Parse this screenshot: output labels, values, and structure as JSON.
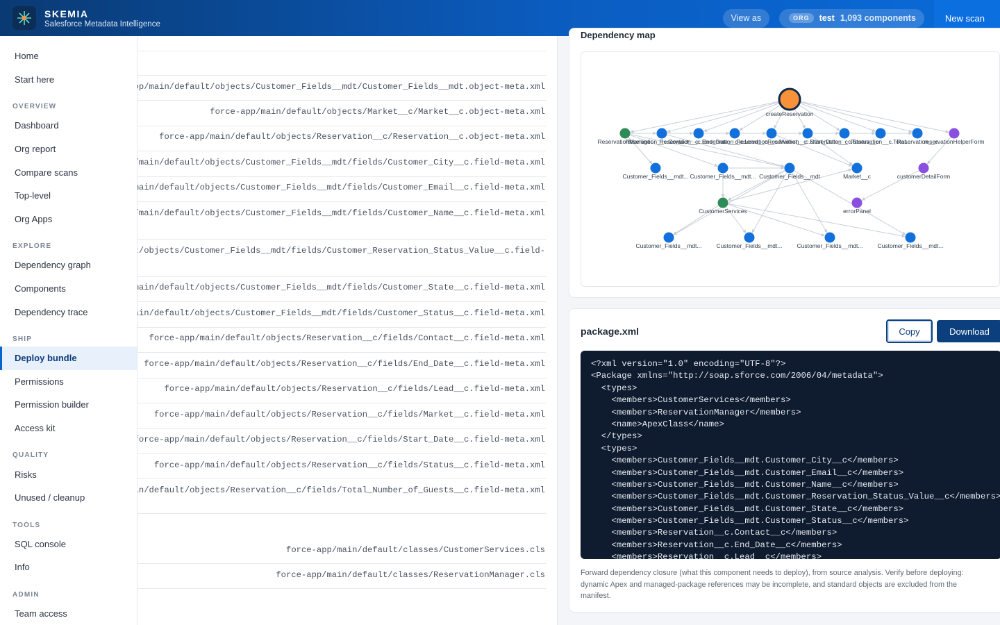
{
  "header": {
    "brand_name": "SKEMIA",
    "brand_sub": "Salesforce Metadata Intelligence",
    "view_as": "View as",
    "org_tag": "ORG",
    "org_name": "test",
    "org_count": "1,093 components",
    "new_scan": "New scan"
  },
  "sidebar": {
    "items": [
      {
        "type": "item",
        "label": "Home"
      },
      {
        "type": "item",
        "label": "Start here"
      },
      {
        "type": "section",
        "label": "OVERVIEW"
      },
      {
        "type": "item",
        "label": "Dashboard"
      },
      {
        "type": "item",
        "label": "Org report"
      },
      {
        "type": "item",
        "label": "Compare scans"
      },
      {
        "type": "item",
        "label": "Top-level"
      },
      {
        "type": "item",
        "label": "Org Apps"
      },
      {
        "type": "section",
        "label": "EXPLORE"
      },
      {
        "type": "item",
        "label": "Dependency graph"
      },
      {
        "type": "item",
        "label": "Components"
      },
      {
        "type": "item",
        "label": "Dependency trace"
      },
      {
        "type": "section",
        "label": "SHIP"
      },
      {
        "type": "item",
        "label": "Deploy bundle",
        "active": true
      },
      {
        "type": "item",
        "label": "Permissions"
      },
      {
        "type": "item",
        "label": "Permission builder"
      },
      {
        "type": "item",
        "label": "Access kit"
      },
      {
        "type": "section",
        "label": "QUALITY"
      },
      {
        "type": "item",
        "label": "Risks"
      },
      {
        "type": "item",
        "label": "Unused / cleanup"
      },
      {
        "type": "section",
        "label": "TOOLS"
      },
      {
        "type": "item",
        "label": "SQL console"
      },
      {
        "type": "item",
        "label": "Info"
      },
      {
        "type": "section",
        "label": "ADMIN"
      },
      {
        "type": "item",
        "label": "Team access"
      }
    ]
  },
  "files": [
    "force-app/main/default/objects/Customer_Fields__mdt/Customer_Fields__mdt.object-meta.xml",
    "force-app/main/default/objects/Market__c/Market__c.object-meta.xml",
    "force-app/main/default/objects/Reservation__c/Reservation__c.object-meta.xml",
    "force-app/main/default/objects/Customer_Fields__mdt/fields/Customer_City__c.field-meta.xml",
    "force-app/main/default/objects/Customer_Fields__mdt/fields/Customer_Email__c.field-meta.xml",
    "force-app/main/default/objects/Customer_Fields__mdt/fields/Customer_Name__c.field-meta.xml",
    "force-app/main/default/objects/Customer_Fields__mdt/fields/Customer_Reservation_Status_Value__c.field-",
    "force-app/main/default/objects/Customer_Fields__mdt/fields/Customer_State__c.field-meta.xml",
    "force-app/main/default/objects/Customer_Fields__mdt/fields/Customer_Status__c.field-meta.xml",
    "force-app/main/default/objects/Reservation__c/fields/Contact__c.field-meta.xml",
    "force-app/main/default/objects/Reservation__c/fields/End_Date__c.field-meta.xml",
    "force-app/main/default/objects/Reservation__c/fields/Lead__c.field-meta.xml",
    "force-app/main/default/objects/Reservation__c/fields/Market__c.field-meta.xml",
    "force-app/main/default/objects/Reservation__c/fields/Start_Date__c.field-meta.xml",
    "force-app/main/default/objects/Reservation__c/fields/Status__c.field-meta.xml",
    "force-app/main/default/objects/Reservation__c/fields/Total_Number_of_Guests__c.field-meta.xml",
    "force-app/main/default/classes/CustomerServices.cls",
    "force-app/main/default/classes/ReservationManager.cls"
  ],
  "graph": {
    "title": "Dependency map",
    "colors": {
      "root": "#f7923a",
      "blue": "#1170db",
      "green": "#2e8b57",
      "purple": "#8a4fe0"
    },
    "nodes": [
      {
        "id": "root",
        "label": "createReservation",
        "color": "root"
      },
      {
        "id": "n1",
        "label": "ReservationManager",
        "color": "green"
      },
      {
        "id": "n2",
        "label": "Reservation__c.Contact__c",
        "color": "blue"
      },
      {
        "id": "n3",
        "label": "Reservation__c.End_Date__c",
        "color": "blue"
      },
      {
        "id": "n4",
        "label": "Reservation__c.Lead__c",
        "color": "blue"
      },
      {
        "id": "n5",
        "label": "Reservation__c.Market__c",
        "color": "blue"
      },
      {
        "id": "n6",
        "label": "Reservation__c.Start_Date__c",
        "color": "blue"
      },
      {
        "id": "n7",
        "label": "Reservation__c.Status__c",
        "color": "blue"
      },
      {
        "id": "n8",
        "label": "Reservation__c.Total...",
        "color": "blue"
      },
      {
        "id": "n9",
        "label": "Reservation__c",
        "color": "blue"
      },
      {
        "id": "n10",
        "label": "reservationHelperForm",
        "color": "purple"
      },
      {
        "id": "m1",
        "label": "Customer_Fields__mdt...",
        "color": "blue"
      },
      {
        "id": "m2",
        "label": "Customer_Fields__mdt...",
        "color": "blue"
      },
      {
        "id": "m3",
        "label": "Customer_Fields__mdt",
        "color": "blue"
      },
      {
        "id": "m4",
        "label": "Market__c",
        "color": "blue"
      },
      {
        "id": "m5",
        "label": "customerDetailForm",
        "color": "purple"
      },
      {
        "id": "c1",
        "label": "CustomerServices",
        "color": "green"
      },
      {
        "id": "c2",
        "label": "errorPanel",
        "color": "purple"
      },
      {
        "id": "b1",
        "label": "Customer_Fields__mdt...",
        "color": "blue"
      },
      {
        "id": "b2",
        "label": "Customer_Fields__mdt...",
        "color": "blue"
      },
      {
        "id": "b3",
        "label": "Customer_Fields__mdt...",
        "color": "blue"
      },
      {
        "id": "b4",
        "label": "Customer_Fields__mdt...",
        "color": "blue"
      }
    ],
    "edges": [
      [
        "root",
        "n1"
      ],
      [
        "root",
        "n2"
      ],
      [
        "root",
        "n3"
      ],
      [
        "root",
        "n4"
      ],
      [
        "root",
        "n5"
      ],
      [
        "root",
        "n6"
      ],
      [
        "root",
        "n7"
      ],
      [
        "root",
        "n8"
      ],
      [
        "root",
        "n9"
      ],
      [
        "root",
        "n10"
      ],
      [
        "n1",
        "n2"
      ],
      [
        "n2",
        "n3"
      ],
      [
        "n3",
        "n4"
      ],
      [
        "n4",
        "n5"
      ],
      [
        "n5",
        "n6"
      ],
      [
        "n6",
        "n7"
      ],
      [
        "n7",
        "n8"
      ],
      [
        "n8",
        "n9"
      ],
      [
        "n1",
        "m1"
      ],
      [
        "n1",
        "m2"
      ],
      [
        "n1",
        "m3"
      ],
      [
        "n2",
        "m3"
      ],
      [
        "n5",
        "m4"
      ],
      [
        "n10",
        "m5"
      ],
      [
        "n6",
        "m4"
      ],
      [
        "m2",
        "m3"
      ],
      [
        "m3",
        "c1"
      ],
      [
        "m2",
        "c1"
      ],
      [
        "m5",
        "c2"
      ],
      [
        "c1",
        "m4"
      ],
      [
        "c1",
        "b1"
      ],
      [
        "c1",
        "b2"
      ],
      [
        "c1",
        "b3"
      ],
      [
        "c1",
        "b4"
      ],
      [
        "m3",
        "b1"
      ],
      [
        "m3",
        "b2"
      ],
      [
        "m3",
        "b3"
      ],
      [
        "m3",
        "b4"
      ]
    ]
  },
  "package": {
    "title": "package.xml",
    "copy_label": "Copy",
    "download_label": "Download",
    "lines": [
      "<?xml version=\"1.0\" encoding=\"UTF-8\"?>",
      "<Package xmlns=\"http://soap.sforce.com/2006/04/metadata\">",
      "  <types>",
      "    <members>CustomerServices</members>",
      "    <members>ReservationManager</members>",
      "    <name>ApexClass</name>",
      "  </types>",
      "  <types>",
      "    <members>Customer_Fields__mdt.Customer_City__c</members>",
      "    <members>Customer_Fields__mdt.Customer_Email__c</members>",
      "    <members>Customer_Fields__mdt.Customer_Name__c</members>",
      "    <members>Customer_Fields__mdt.Customer_Reservation_Status_Value__c</members>",
      "    <members>Customer_Fields__mdt.Customer_State__c</members>",
      "    <members>Customer_Fields__mdt.Customer_Status__c</members>",
      "    <members>Reservation__c.Contact__c</members>",
      "    <members>Reservation__c.End_Date__c</members>",
      "    <members>Reservation__c.Lead__c</members>"
    ],
    "footnote": "Forward dependency closure (what this component needs to deploy), from source analysis. Verify before deploying: dynamic Apex and managed-package references may be incomplete, and standard objects are excluded from the manifest."
  }
}
